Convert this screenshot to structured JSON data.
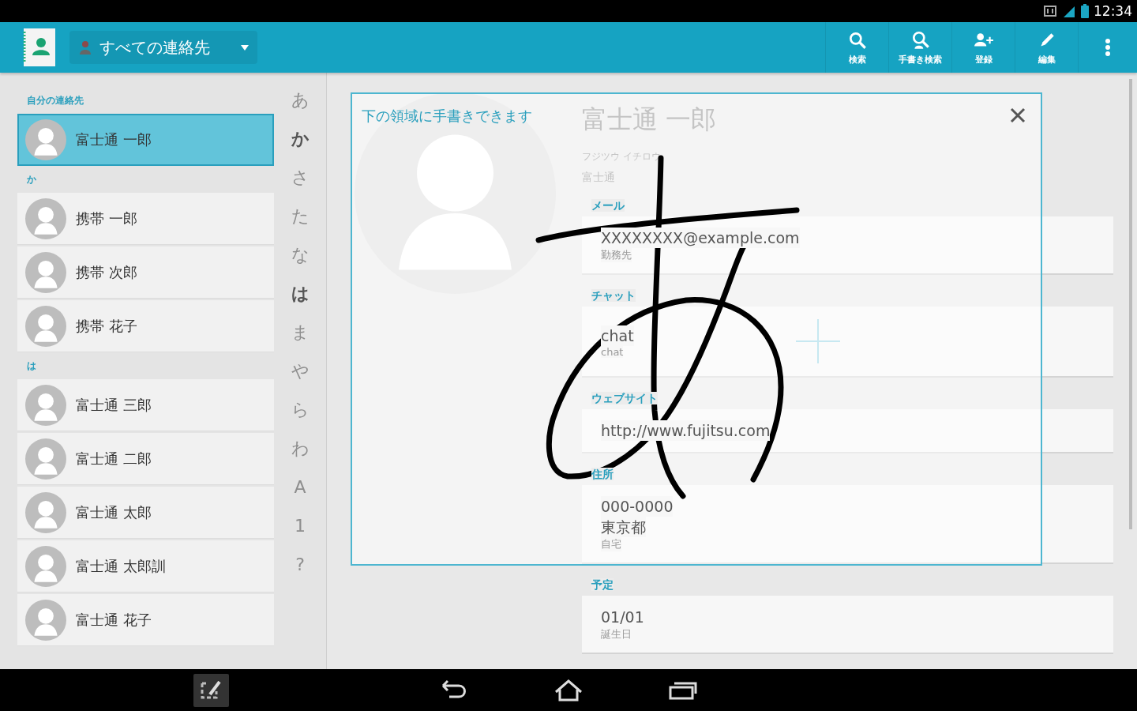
{
  "status_bar": {
    "time": "12:34"
  },
  "action_bar": {
    "filter": "すべての連絡先",
    "actions": [
      {
        "kind": "search",
        "label": "検索"
      },
      {
        "kind": "handwriting-search",
        "label": "手書き検索"
      },
      {
        "kind": "add-contact",
        "label": "登録"
      },
      {
        "kind": "edit",
        "label": "編集"
      },
      {
        "kind": "overflow"
      }
    ]
  },
  "contact_list": [
    {
      "header": "自分の連絡先",
      "contacts": [
        {
          "name": "富士通 一郎",
          "selected": true
        }
      ]
    },
    {
      "header": "か",
      "contacts": [
        {
          "name": "携帯 一郎",
          "selected": false
        },
        {
          "name": "携帯 次郎",
          "selected": false
        },
        {
          "name": "携帯 花子",
          "selected": false
        }
      ]
    },
    {
      "header": "は",
      "contacts": [
        {
          "name": "富士通 三郎",
          "selected": false
        },
        {
          "name": "富士通 二郎",
          "selected": false
        },
        {
          "name": "富士通 太郎",
          "selected": false
        },
        {
          "name": "富士通 太郎訓",
          "selected": false
        },
        {
          "name": "富士通 花子",
          "selected": false
        }
      ]
    }
  ],
  "index": [
    {
      "label": "あ",
      "enabled": false
    },
    {
      "label": "か",
      "enabled": true
    },
    {
      "label": "さ",
      "enabled": false
    },
    {
      "label": "た",
      "enabled": false
    },
    {
      "label": "な",
      "enabled": false
    },
    {
      "label": "は",
      "enabled": true
    },
    {
      "label": "ま",
      "enabled": false
    },
    {
      "label": "や",
      "enabled": false
    },
    {
      "label": "ら",
      "enabled": false
    },
    {
      "label": "わ",
      "enabled": false
    },
    {
      "label": "A",
      "enabled": false
    },
    {
      "label": "1",
      "enabled": false
    },
    {
      "label": "?",
      "enabled": false
    }
  ],
  "detail": {
    "name": "富士通 一郎",
    "phonetic": "フジツウ イチロウ",
    "company": "富士通",
    "sections": [
      {
        "kind": "email",
        "title": "メール",
        "entries": [
          {
            "value": "XXXXXXXX@example.com",
            "type": "勤務先"
          }
        ]
      },
      {
        "kind": "chat",
        "title": "チャット",
        "entries": [
          {
            "value": "chat",
            "type": "chat"
          }
        ]
      },
      {
        "kind": "website",
        "title": "ウェブサイト",
        "entries": [
          {
            "value": "http://www.fujitsu.com"
          }
        ]
      },
      {
        "kind": "address",
        "title": "住所",
        "entries": [
          {
            "lines": [
              "000-0000",
              "東京都"
            ],
            "type": "自宅"
          }
        ]
      },
      {
        "kind": "event",
        "title": "予定",
        "entries": [
          {
            "value": "01/01",
            "type": "誕生日"
          }
        ]
      }
    ]
  },
  "handwriting_panel": {
    "hint": "下の領域に手書きできます"
  }
}
